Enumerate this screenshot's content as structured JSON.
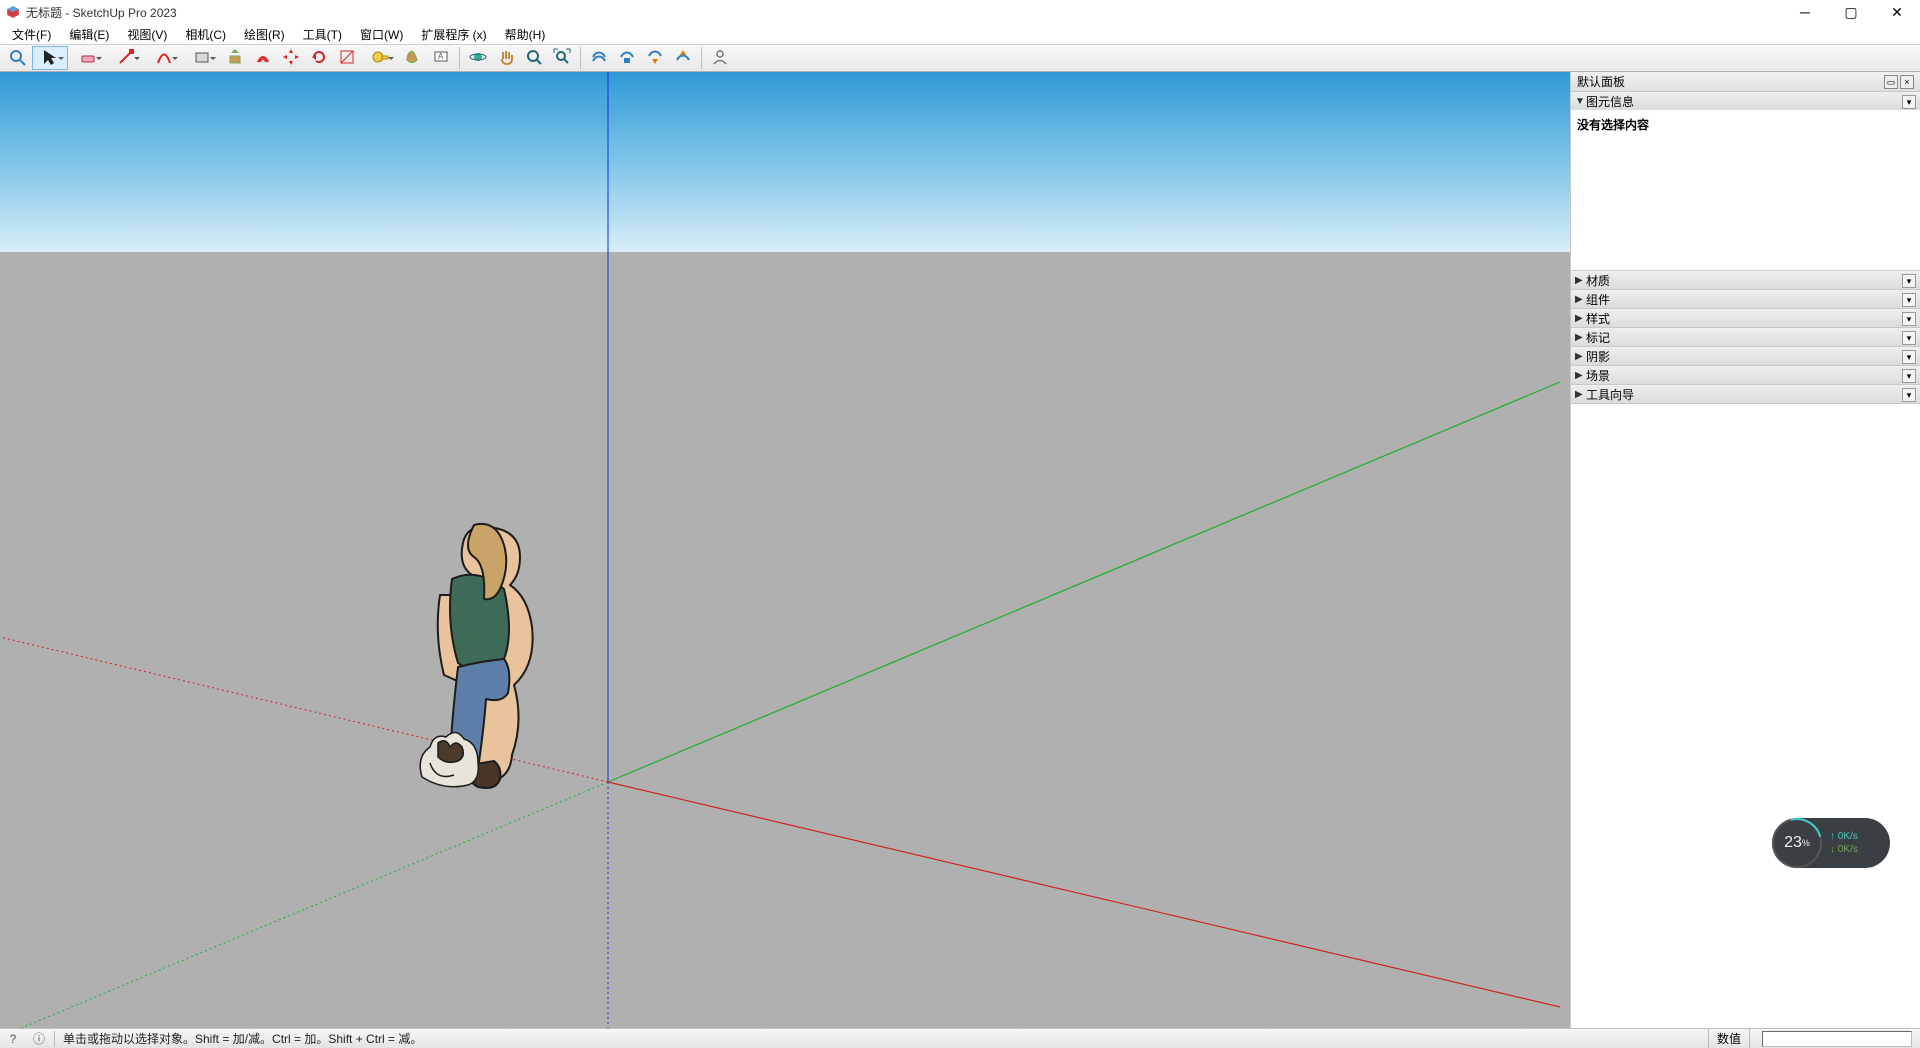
{
  "window": {
    "title": "无标题 - SketchUp Pro 2023"
  },
  "menu": [
    {
      "label": "文件(F)"
    },
    {
      "label": "编辑(E)"
    },
    {
      "label": "视图(V)"
    },
    {
      "label": "相机(C)"
    },
    {
      "label": "绘图(R)"
    },
    {
      "label": "工具(T)"
    },
    {
      "label": "窗口(W)"
    },
    {
      "label": "扩展程序 (x)"
    },
    {
      "label": "帮助(H)"
    }
  ],
  "toolbar": [
    {
      "name": "search",
      "color": "#2c80c8"
    },
    {
      "name": "select",
      "dd": true,
      "active": true
    },
    {
      "name": "eraser",
      "dd": true
    },
    {
      "name": "line",
      "dd": true
    },
    {
      "name": "arc",
      "dd": true
    },
    {
      "name": "rectangle",
      "dd": true
    },
    {
      "name": "pushpull"
    },
    {
      "name": "offset"
    },
    {
      "name": "move"
    },
    {
      "name": "rotate"
    },
    {
      "name": "scale"
    },
    {
      "name": "tape",
      "dd": true
    },
    {
      "name": "paint"
    },
    {
      "name": "text"
    },
    {
      "sep": true
    },
    {
      "name": "orbit"
    },
    {
      "name": "pan"
    },
    {
      "name": "zoom"
    },
    {
      "name": "zoom-extents"
    },
    {
      "sep": true
    },
    {
      "name": "warehouse-3d"
    },
    {
      "name": "warehouse-ext"
    },
    {
      "name": "warehouse-down"
    },
    {
      "name": "warehouse-up"
    },
    {
      "sep": true
    },
    {
      "name": "user"
    }
  ],
  "tray": {
    "title": "默认面板",
    "sections": [
      {
        "label": "图元信息",
        "expanded": true,
        "body": "没有选择内容"
      },
      {
        "label": "材质",
        "expanded": false
      },
      {
        "label": "组件",
        "expanded": false
      },
      {
        "label": "样式",
        "expanded": false
      },
      {
        "label": "标记",
        "expanded": false
      },
      {
        "label": "阴影",
        "expanded": false
      },
      {
        "label": "场景",
        "expanded": false
      },
      {
        "label": "工具向导",
        "expanded": false
      }
    ]
  },
  "statusbar": {
    "hint": "单击或拖动以选择对象。Shift = 加/减。Ctrl = 加。Shift + Ctrl = 减。",
    "measurement_label": "数值"
  },
  "net_widget": {
    "percent": "23",
    "percent_suffix": "%",
    "up": "0K/s",
    "down": "0K/s"
  }
}
